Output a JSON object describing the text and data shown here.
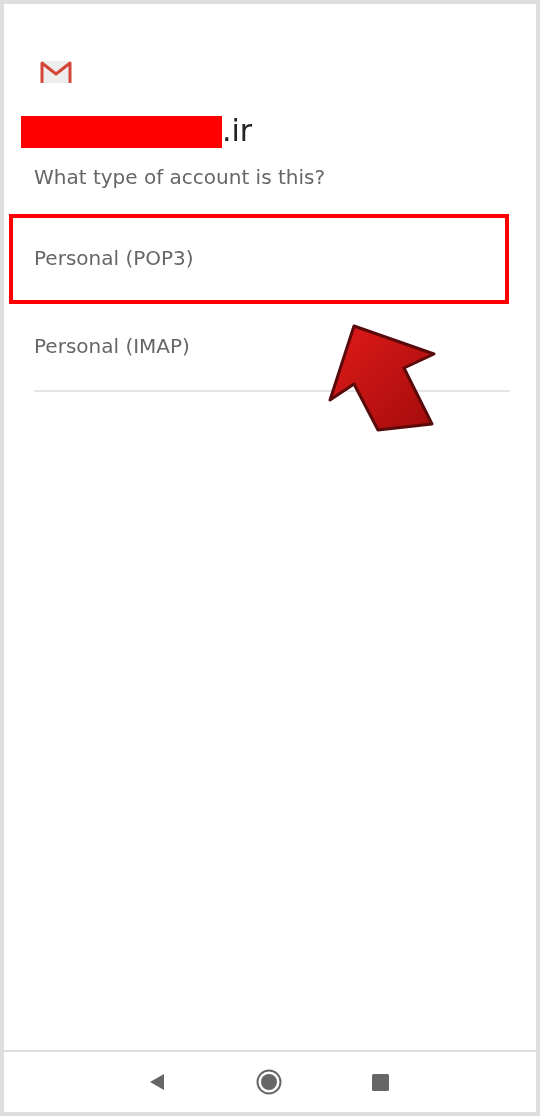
{
  "account": {
    "domain_suffix": ".ir",
    "redacted": true
  },
  "question": "What type of account is this?",
  "options": [
    {
      "label": "Personal (POP3)",
      "highlighted": true
    },
    {
      "label": "Personal (IMAP)",
      "highlighted": false
    }
  ],
  "annotation_arrow": true
}
